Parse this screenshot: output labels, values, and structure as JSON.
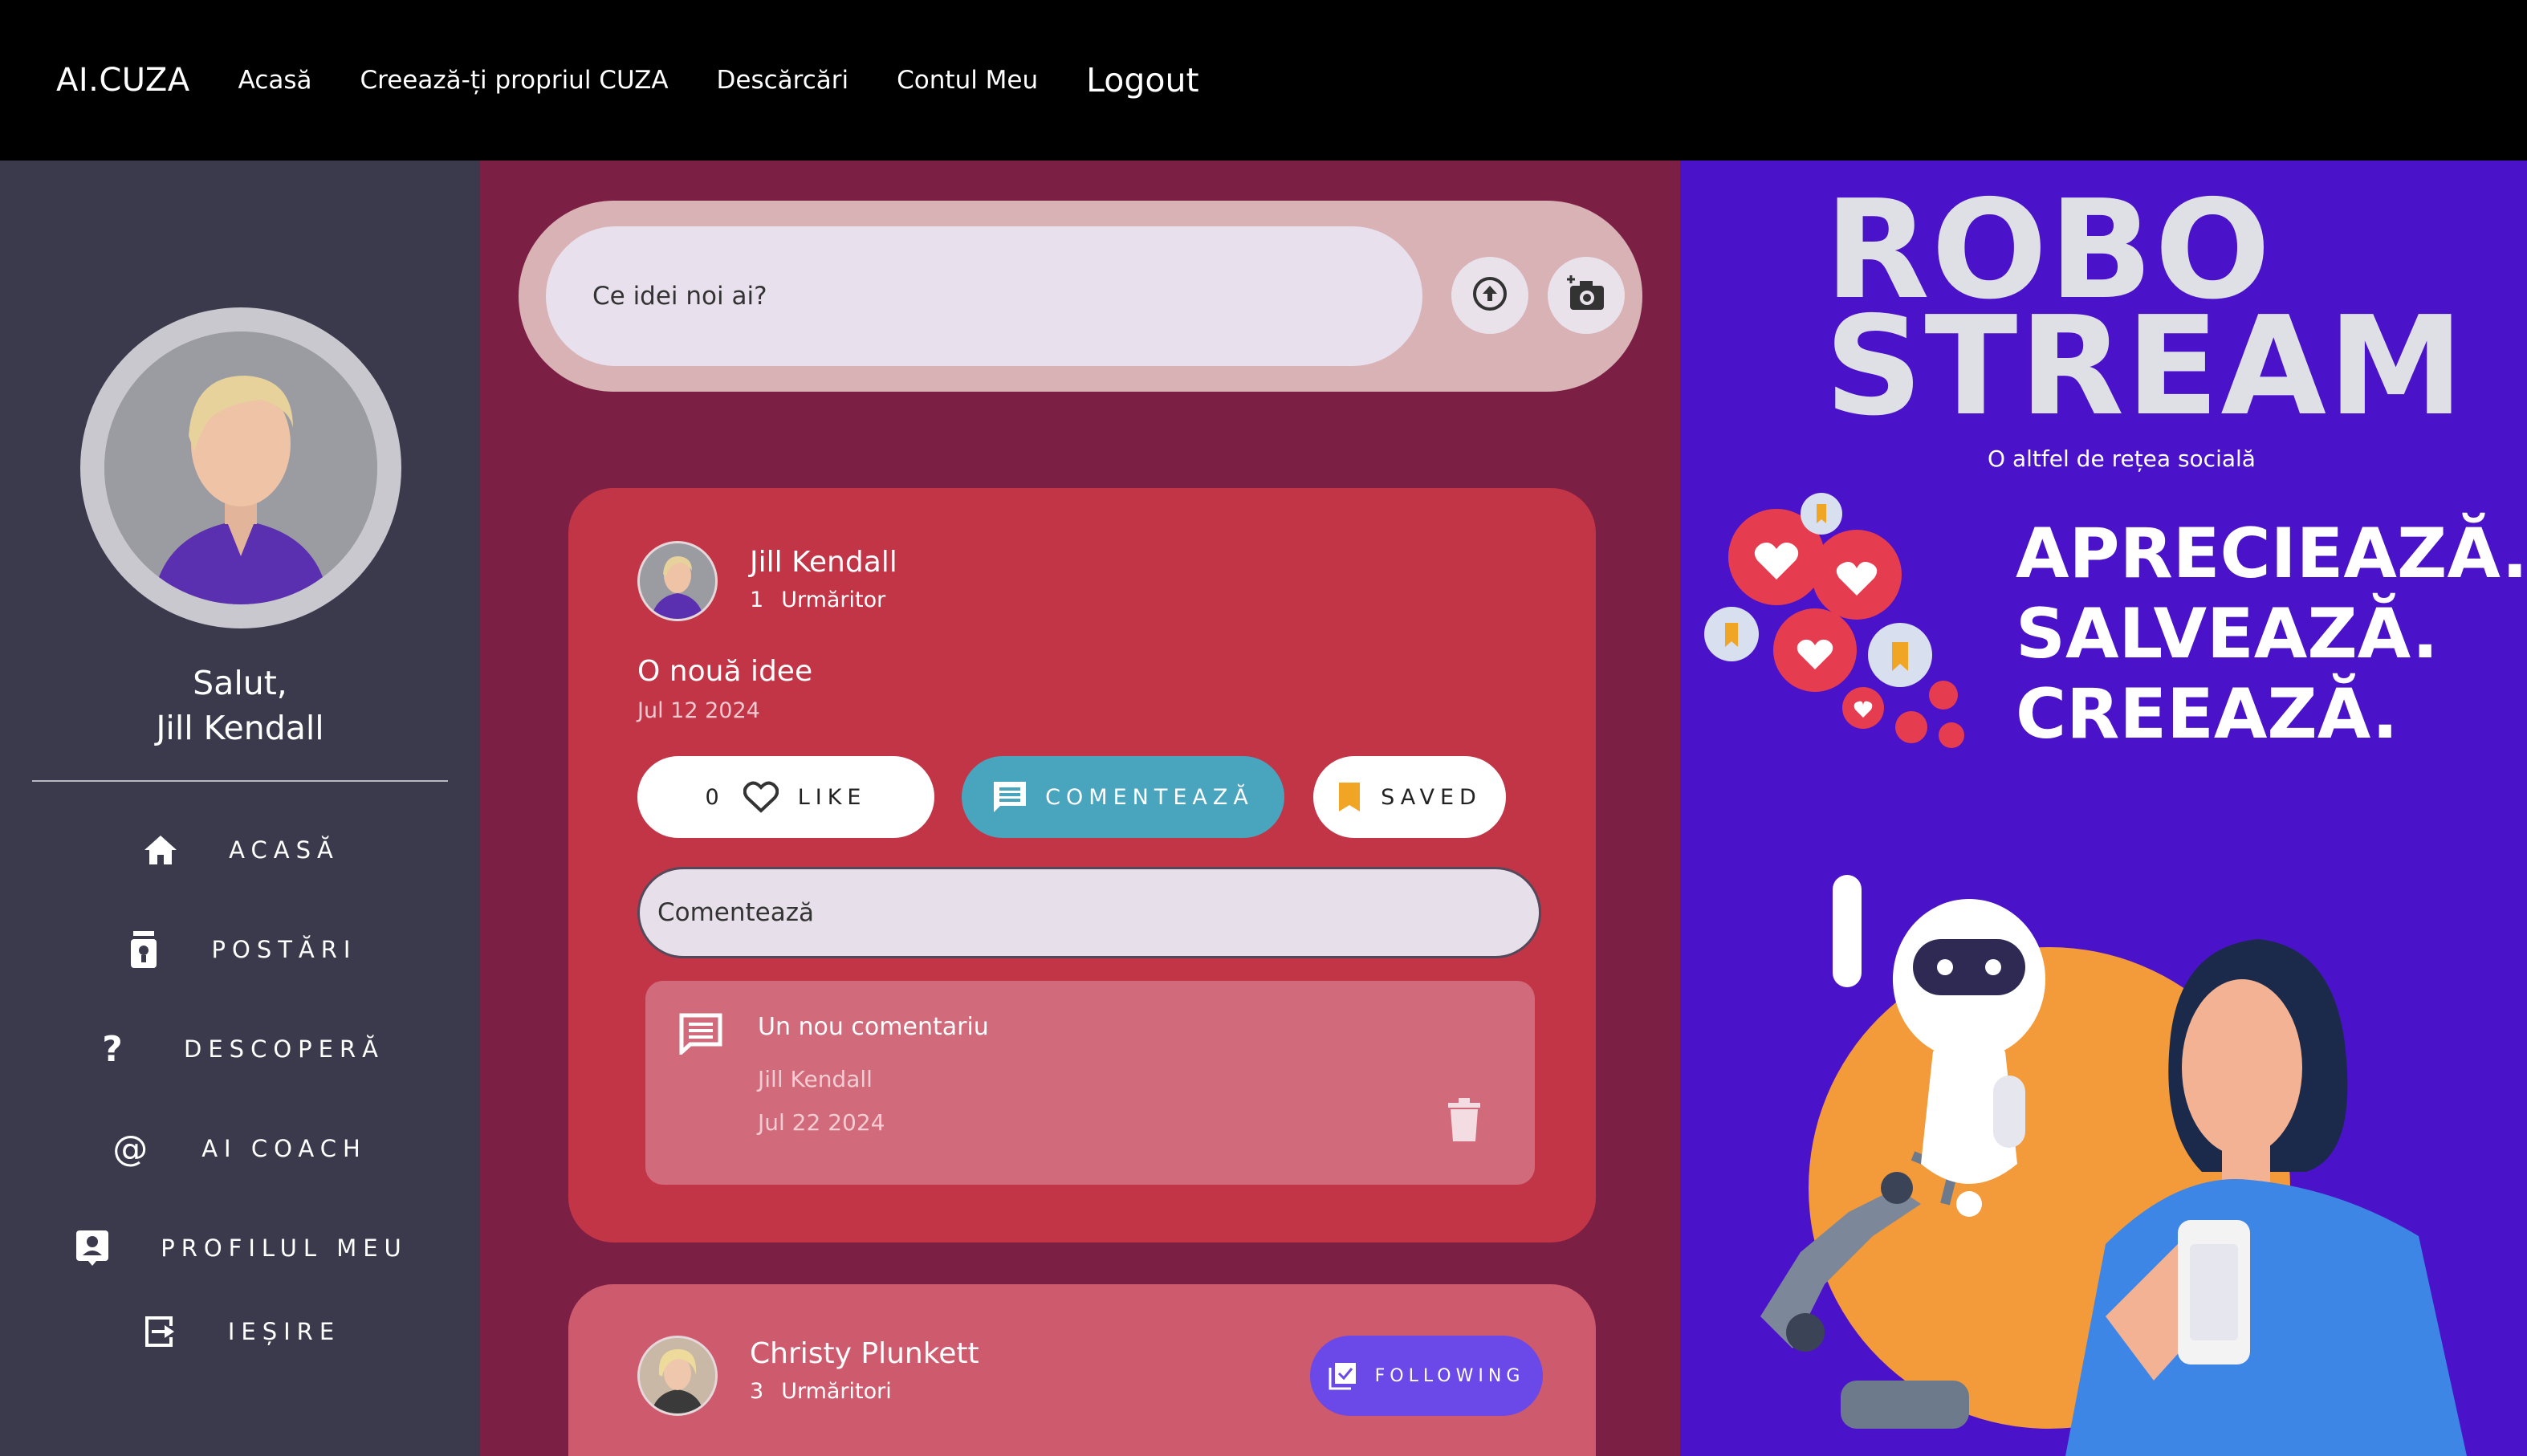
{
  "nav": {
    "brand": "AI.CUZA",
    "links": [
      "Acasă",
      "Creează-ți propriul CUZA",
      "Descărcări",
      "Contul Meu"
    ],
    "logout": "Logout"
  },
  "sidebar": {
    "greeting_line1": "Salut,",
    "greeting_line2": "Jill Kendall",
    "items": [
      {
        "label": "ACASĂ",
        "icon": "home-icon"
      },
      {
        "label": "POSTĂRI",
        "icon": "posts-icon"
      },
      {
        "label": "DESCOPERĂ",
        "icon": "question-icon"
      },
      {
        "label": "AI COACH",
        "icon": "at-icon"
      },
      {
        "label": "PROFILUL MEU",
        "icon": "profile-icon"
      },
      {
        "label": "IEȘIRE",
        "icon": "exit-icon"
      }
    ]
  },
  "composer": {
    "placeholder": "Ce idei noi ai?",
    "upload_icon": "upload-icon",
    "camera_icon": "camera-icon"
  },
  "posts": [
    {
      "author": "Jill Kendall",
      "followers_count": "1",
      "followers_label": "Urmăritor",
      "title": "O nouă idee",
      "date": "Jul 12 2024",
      "like_count": "0",
      "like_label": "LIKE",
      "comment_label": "COMENTEAZĂ",
      "saved_label": "SAVED",
      "comment_placeholder": "Comentează",
      "comments": [
        {
          "text": "Un nou comentariu",
          "author": "Jill Kendall",
          "date": "Jul 22 2024"
        }
      ]
    },
    {
      "author": "Christy Plunkett",
      "followers_count": "3",
      "followers_label": "Urmăritori",
      "following_label": "FOLLOWING"
    }
  ],
  "ad": {
    "title_line1": "ROBO",
    "title_line2": "STREAM",
    "subtitle": "O altfel de rețea socială",
    "slogan": [
      "APRECIEAZĂ.",
      "SALVEAZĂ.",
      "CREEAZĂ."
    ]
  },
  "colors": {
    "nav_bg": "#000000",
    "sidebar_bg": "#3b3a4d",
    "feed_bg": "#7c1f45",
    "post_bg": "#c13547",
    "ad_bg": "#4b13c9",
    "comment_accent": "#49a4be",
    "following_accent": "#6b48e8"
  }
}
